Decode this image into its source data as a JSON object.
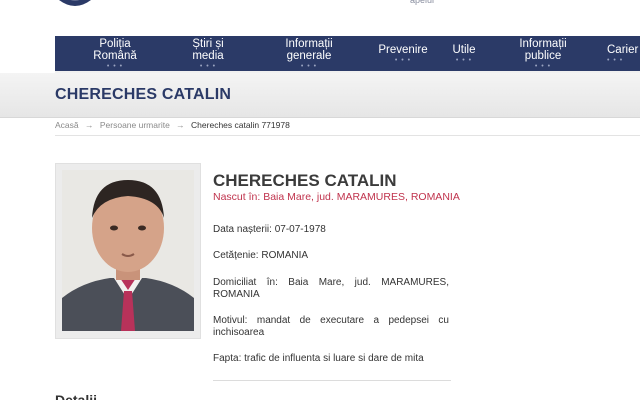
{
  "header": {
    "top_note": "apelul"
  },
  "nav": {
    "items": [
      {
        "line1": "Poliția",
        "line2": "Română"
      },
      {
        "line1": "Știri și",
        "line2": "media"
      },
      {
        "line1": "Informații",
        "line2": "generale"
      },
      {
        "line1": "Prevenire",
        "line2": ""
      },
      {
        "line1": "Utile",
        "line2": ""
      },
      {
        "line1": "Informații",
        "line2": "publice"
      },
      {
        "line1": "Carier",
        "line2": ""
      }
    ],
    "dots": "• • •"
  },
  "page": {
    "band_title": "CHERECHES CATALIN"
  },
  "breadcrumb": {
    "home": "Acasă",
    "sep": "→",
    "section": "Persoane urmarite",
    "current": "Chereches catalin 771978"
  },
  "person": {
    "name": "CHERECHES CATALIN",
    "born": "Nascut în: Baia Mare, jud. MARAMURES, ROMANIA",
    "dob": "Data nașterii: 07-07-1978",
    "citizenship": "Cetățenie: ROMANIA",
    "domicile": "Domiciliat în: Baia Mare, jud. MARAMURES, ROMANIA",
    "motive": "Motivul: mandat de executare a pedepsei cu inchisoarea",
    "deed": "Fapta: trafic de influenta si luare si dare de mita"
  },
  "section": {
    "peek": "Detalii"
  },
  "colors": {
    "nav_bg": "#2b3a67",
    "accent_red": "#c0334d",
    "title_blue": "#2b3a67"
  }
}
